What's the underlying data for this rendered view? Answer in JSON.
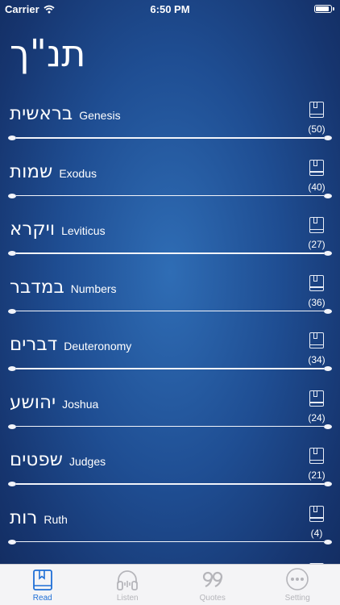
{
  "status_bar": {
    "carrier": "Carrier",
    "time": "6:50 PM"
  },
  "header": {
    "title": "תנ\"ך"
  },
  "books": [
    {
      "hebrew": "בראשית",
      "english": "Genesis",
      "chapters": "(50)"
    },
    {
      "hebrew": "שמות",
      "english": "Exodus",
      "chapters": "(40)"
    },
    {
      "hebrew": "ויקרא",
      "english": "Leviticus",
      "chapters": "(27)"
    },
    {
      "hebrew": "במדבר",
      "english": "Numbers",
      "chapters": "(36)"
    },
    {
      "hebrew": "דברים",
      "english": "Deuteronomy",
      "chapters": "(34)"
    },
    {
      "hebrew": "יהושע",
      "english": "Joshua",
      "chapters": "(24)"
    },
    {
      "hebrew": "שפטים",
      "english": "Judges",
      "chapters": "(21)"
    },
    {
      "hebrew": "רות",
      "english": "Ruth",
      "chapters": "(4)"
    }
  ],
  "tabs": [
    {
      "label": "Read",
      "icon": "book-icon",
      "active": true
    },
    {
      "label": "Listen",
      "icon": "headphones-icon",
      "active": false
    },
    {
      "label": "Quotes",
      "icon": "quote-icon",
      "active": false
    },
    {
      "label": "Setting",
      "icon": "more-icon",
      "active": false
    }
  ],
  "colors": {
    "accent": "#1f6fd6",
    "inactive": "#b5b5ba",
    "background": "#1f4e93"
  }
}
